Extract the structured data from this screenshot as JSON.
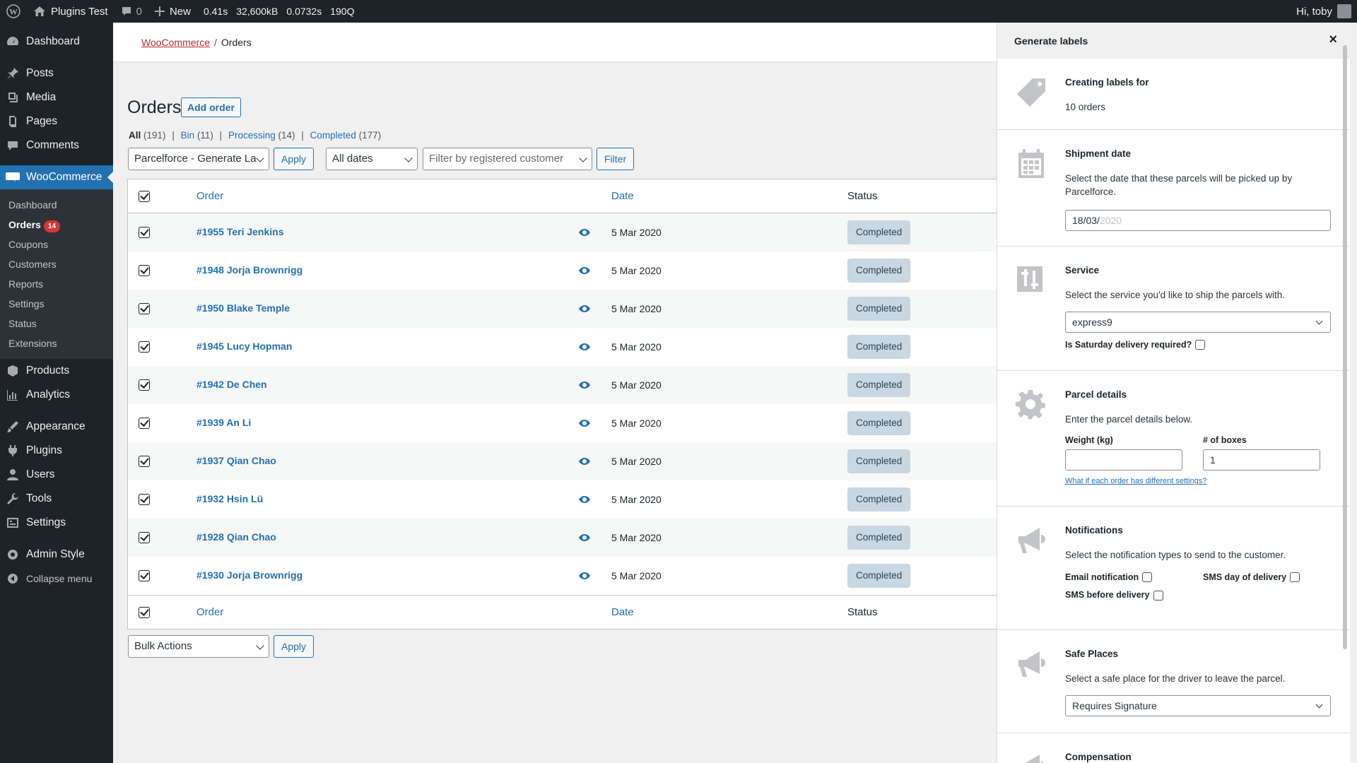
{
  "adminbar": {
    "site_name": "Plugins Test",
    "comments_count": "0",
    "new_label": "New",
    "stats": [
      "0.41s",
      "32,600kB",
      "0.0732s",
      "190Q"
    ],
    "greeting": "Hi, toby"
  },
  "sidebar": {
    "top_items": [
      {
        "label": "Dashboard",
        "icon": "dashboard-icon"
      },
      {
        "label": "Posts",
        "icon": "pin-icon"
      },
      {
        "label": "Media",
        "icon": "media-icon"
      },
      {
        "label": "Pages",
        "icon": "pages-icon"
      },
      {
        "label": "Comments",
        "icon": "comment-icon"
      },
      {
        "label": "WooCommerce",
        "icon": "woo-icon"
      }
    ],
    "woo_submenu": [
      "Dashboard",
      "Orders",
      "Coupons",
      "Customers",
      "Reports",
      "Settings",
      "Status",
      "Extensions"
    ],
    "orders_badge": "14",
    "bottom_items": [
      {
        "label": "Products",
        "icon": "products-icon"
      },
      {
        "label": "Analytics",
        "icon": "analytics-icon"
      },
      {
        "label": "Appearance",
        "icon": "appearance-icon"
      },
      {
        "label": "Plugins",
        "icon": "plugins-icon"
      },
      {
        "label": "Users",
        "icon": "users-icon"
      },
      {
        "label": "Tools",
        "icon": "tools-icon"
      },
      {
        "label": "Settings",
        "icon": "settings-icon"
      },
      {
        "label": "Admin Style",
        "icon": "gear-icon"
      },
      {
        "label": "Collapse menu",
        "icon": "collapse-icon"
      }
    ]
  },
  "breadcrumb": {
    "parent": "WooCommerce",
    "current": "Orders"
  },
  "page": {
    "title": "Orders",
    "add_button": "Add order",
    "filters": {
      "all": "All",
      "all_count": "(191)",
      "bin": "Bin",
      "bin_count": "(11)",
      "processing": "Processing",
      "processing_count": "(14)",
      "completed": "Completed",
      "completed_count": "(177)",
      "sep": "|"
    },
    "bulk_action_top": "Parcelforce - Generate La",
    "apply_label": "Apply",
    "dates_select": "All dates",
    "customer_placeholder": "Filter by registered customer",
    "filter_button": "Filter",
    "bulk_action_bottom": "Bulk Actions"
  },
  "table": {
    "headers": {
      "order": "Order",
      "date": "Date",
      "status": "Status"
    },
    "rows": [
      {
        "order": "#1955 Teri Jenkins",
        "date": "5 Mar 2020",
        "status": "Completed"
      },
      {
        "order": "#1948 Jorja Brownrigg",
        "date": "5 Mar 2020",
        "status": "Completed"
      },
      {
        "order": "#1950 Blake Temple",
        "date": "5 Mar 2020",
        "status": "Completed"
      },
      {
        "order": "#1945 Lucy Hopman",
        "date": "5 Mar 2020",
        "status": "Completed"
      },
      {
        "order": "#1942 De Chen",
        "date": "5 Mar 2020",
        "status": "Completed"
      },
      {
        "order": "#1939 An Li",
        "date": "5 Mar 2020",
        "status": "Completed"
      },
      {
        "order": "#1937 Qian Chao",
        "date": "5 Mar 2020",
        "status": "Completed"
      },
      {
        "order": "#1932 Hsin Lü",
        "date": "5 Mar 2020",
        "status": "Completed"
      },
      {
        "order": "#1928 Qian Chao",
        "date": "5 Mar 2020",
        "status": "Completed"
      },
      {
        "order": "#1930 Jorja Brownrigg",
        "date": "5 Mar 2020",
        "status": "Completed"
      }
    ]
  },
  "panel": {
    "title": "Generate labels",
    "close": "×",
    "creating": {
      "heading": "Creating labels for",
      "text": "10 orders"
    },
    "shipment": {
      "heading": "Shipment date",
      "text": "Select the date that these parcels will be picked up by Parcelforce.",
      "date_value": "18/03/",
      "date_placeholder": "2020"
    },
    "service": {
      "heading": "Service",
      "text": "Select the service you'd like to ship the parcels with.",
      "value": "express9",
      "saturday_label": "Is Saturday delivery required?"
    },
    "parcel": {
      "heading": "Parcel details",
      "text": "Enter the parcel details below.",
      "weight_label": "Weight (kg)",
      "weight_value": "",
      "boxes_label": "# of boxes",
      "boxes_value": "1",
      "link": "What if each order has different settings?"
    },
    "notifications": {
      "heading": "Notifications",
      "text": "Select the notification types to send to the customer.",
      "email_label": "Email notification",
      "sms_day_label": "SMS day of delivery",
      "sms_before_label": "SMS before delivery"
    },
    "safe_places": {
      "heading": "Safe Places",
      "text": "Select a safe place for the driver to leave the parcel.",
      "value": "Requires Signature"
    },
    "compensation": {
      "heading": "Compensation"
    }
  }
}
